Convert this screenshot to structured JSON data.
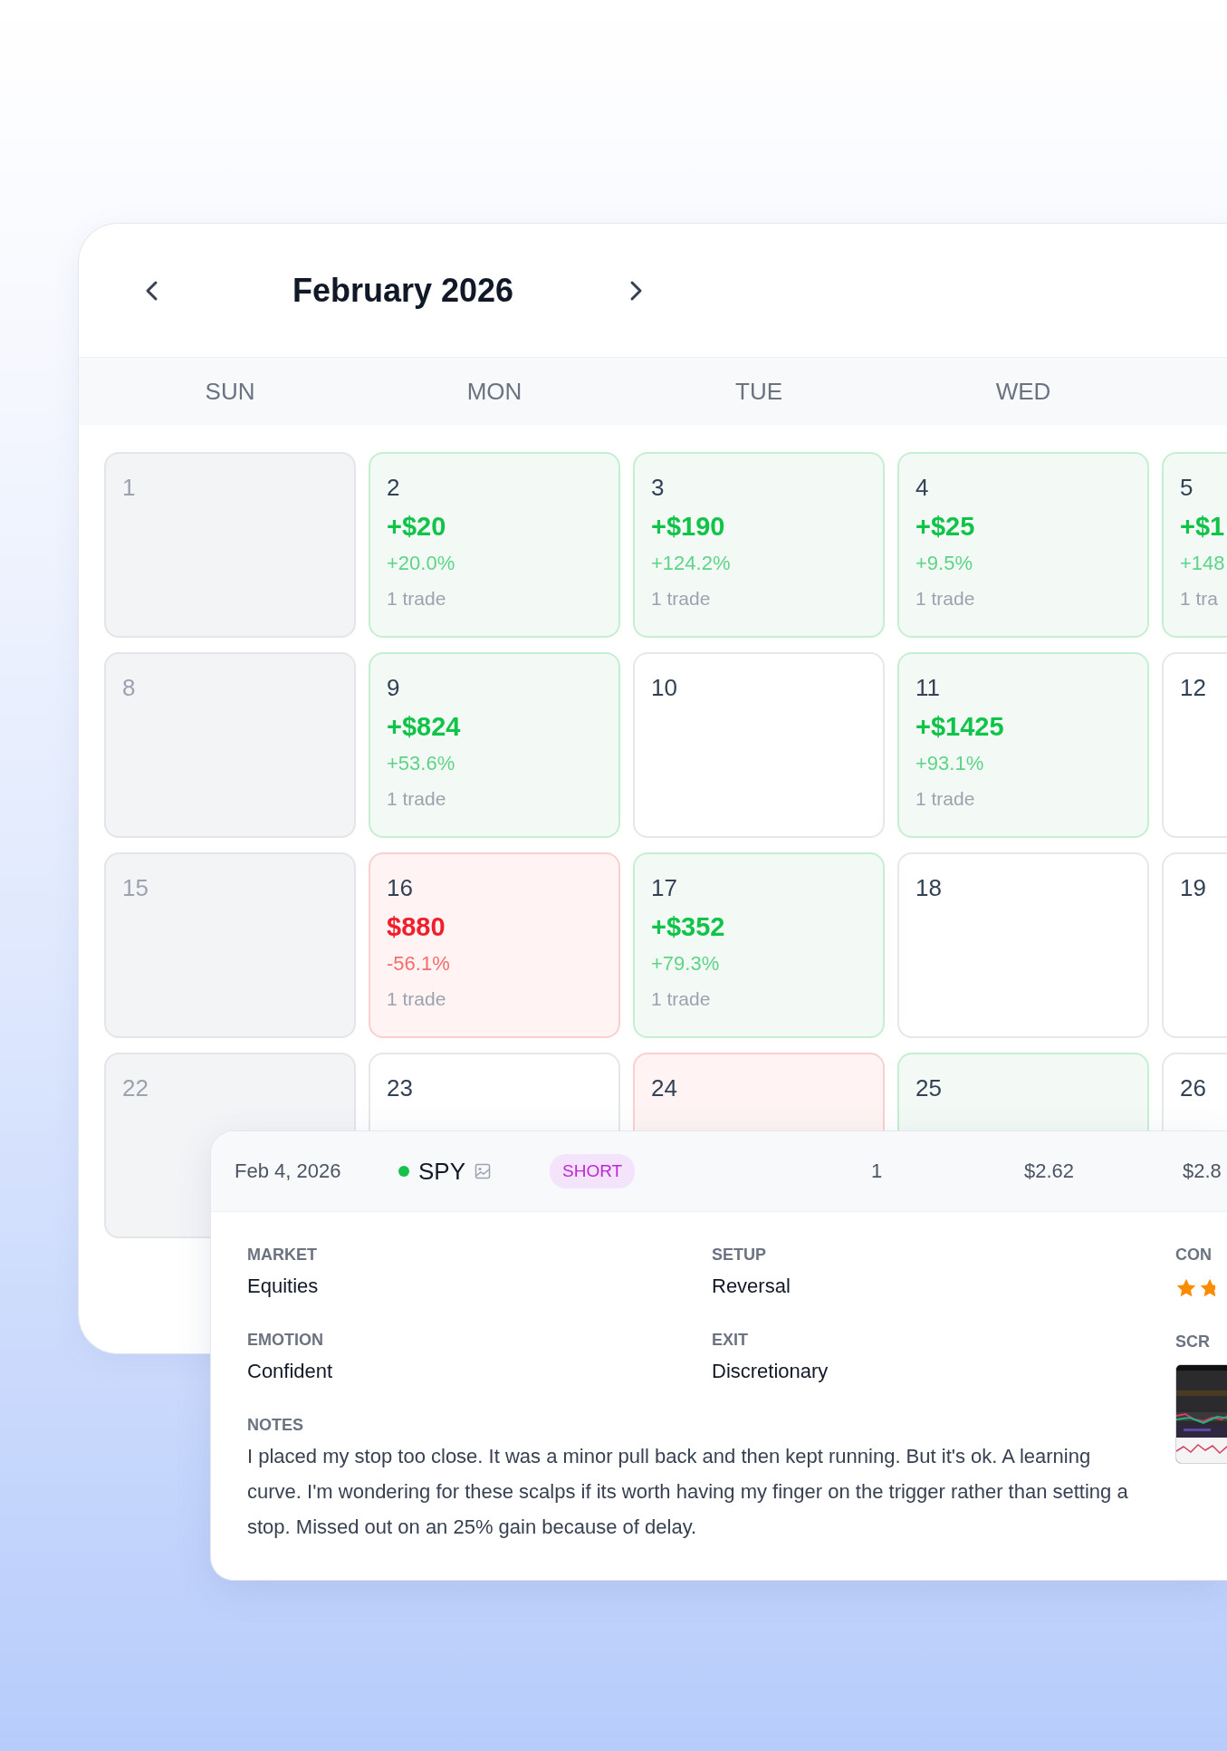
{
  "calendar": {
    "title": "February 2026",
    "weekdays": [
      "SUN",
      "MON",
      "TUE",
      "WED"
    ],
    "weeks": [
      [
        {
          "day": "1",
          "kind": "off"
        },
        {
          "day": "2",
          "kind": "win",
          "pnl": "+$20",
          "pct": "+20.0%",
          "trades": "1 trade"
        },
        {
          "day": "3",
          "kind": "win",
          "pnl": "+$190",
          "pct": "+124.2%",
          "trades": "1 trade"
        },
        {
          "day": "4",
          "kind": "win",
          "pnl": "+$25",
          "pct": "+9.5%",
          "trades": "1 trade"
        },
        {
          "day": "5",
          "kind": "win",
          "pnl": "+$1",
          "pct": "+148",
          "trades": "1 tra"
        }
      ],
      [
        {
          "day": "8",
          "kind": "off"
        },
        {
          "day": "9",
          "kind": "win",
          "pnl": "+$824",
          "pct": "+53.6%",
          "trades": "1 trade"
        },
        {
          "day": "10",
          "kind": "none"
        },
        {
          "day": "11",
          "kind": "win",
          "pnl": "+$1425",
          "pct": "+93.1%",
          "trades": "1 trade"
        },
        {
          "day": "12",
          "kind": "none"
        }
      ],
      [
        {
          "day": "15",
          "kind": "off"
        },
        {
          "day": "16",
          "kind": "loss",
          "pnl": "$880",
          "pct": "-56.1%",
          "trades": "1 trade"
        },
        {
          "day": "17",
          "kind": "win",
          "pnl": "+$352",
          "pct": "+79.3%",
          "trades": "1 trade"
        },
        {
          "day": "18",
          "kind": "none"
        },
        {
          "day": "19",
          "kind": "none"
        }
      ],
      [
        {
          "day": "22",
          "kind": "off"
        },
        {
          "day": "23",
          "kind": "none"
        },
        {
          "day": "24",
          "kind": "loss"
        },
        {
          "day": "25",
          "kind": "win"
        },
        {
          "day": "26",
          "kind": "none"
        }
      ]
    ]
  },
  "trade": {
    "date": "Feb 4, 2026",
    "symbol": "SPY",
    "direction": "SHORT",
    "column_4": "1",
    "column_5": "$2.62",
    "column_6": "$2.8",
    "fields": [
      {
        "label": "MARKET",
        "value": "Equities"
      },
      {
        "label": "SETUP",
        "value": "Reversal"
      },
      {
        "label": "EMOTION",
        "value": "Confident"
      },
      {
        "label": "EXIT",
        "value": "Discretionary"
      }
    ],
    "side_fields": [
      {
        "label": "CON",
        "kind": "stars"
      },
      {
        "label": "SCR",
        "kind": "picture"
      }
    ],
    "notes_label": "NOTES",
    "notes": "I placed my stop too close. It was a minor pull back and then kept running. But it's ok. A learning curve. I'm wondering for these scalps if its worth having my finger on the trigger rather than setting a stop. Missed out on an 25% gain because of delay."
  }
}
